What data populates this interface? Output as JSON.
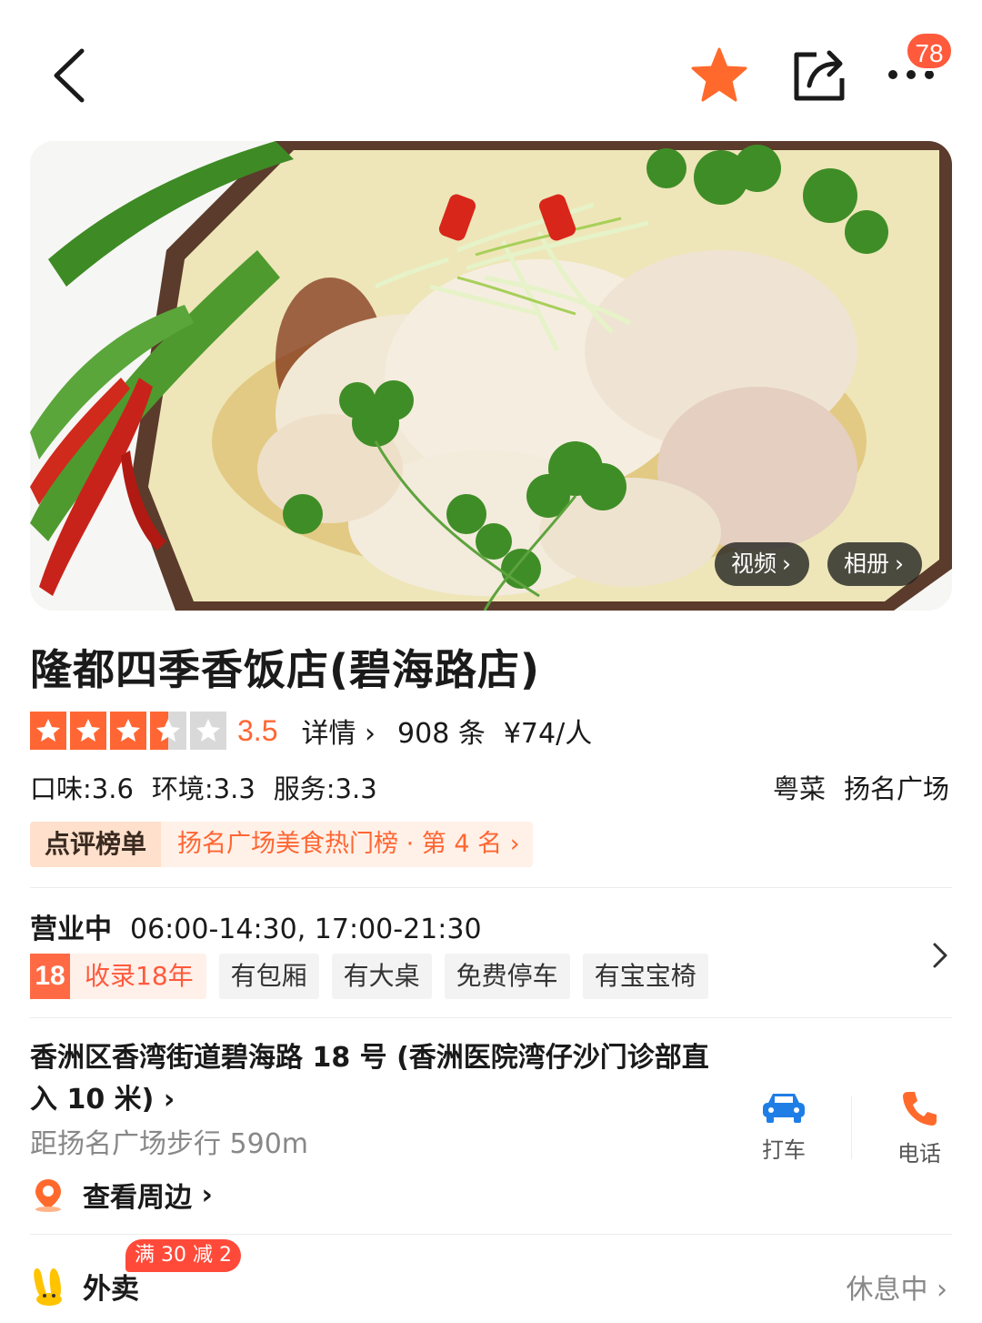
{
  "header": {
    "back_icon": "chevron-left-icon",
    "favorite_icon": "star-icon",
    "share_icon": "share-icon",
    "more_icon": "more-dots-icon",
    "notification_count": "78",
    "accent_color": "#ff6633"
  },
  "gallery": {
    "video_label": "视频",
    "album_label": "相册"
  },
  "shop": {
    "name": "隆都四季香饭店(碧海路店)",
    "rating": 3.5,
    "rating_text": "3.5",
    "detail_label": "详情",
    "review_count": "908 条",
    "price": "¥74/人",
    "scores": [
      "口味:3.6",
      "环境:3.3",
      "服务:3.3"
    ],
    "cuisine": "粤菜",
    "area": "扬名广场"
  },
  "ranking": {
    "tag": "点评榜单",
    "text": "扬名广场美食热门榜 · 第 4 名"
  },
  "hours": {
    "status": "营业中",
    "time": "06:00-14:30, 17:00-21:30"
  },
  "tags": {
    "years_num": "18",
    "years_label": "收录18年",
    "items": [
      "有包厢",
      "有大桌",
      "免费停车",
      "有宝宝椅"
    ]
  },
  "address": {
    "text": "香洲区香湾街道碧海路 18 号 (香洲医院湾仔沙门诊部直入 10 米)",
    "distance": "距扬名广场步行 590m",
    "nearby_label": "查看周边"
  },
  "actions": {
    "taxi_label": "打车",
    "phone_label": "电话"
  },
  "takeaway": {
    "label": "外卖",
    "promo": "满 30 减 2",
    "status": "休息中"
  }
}
